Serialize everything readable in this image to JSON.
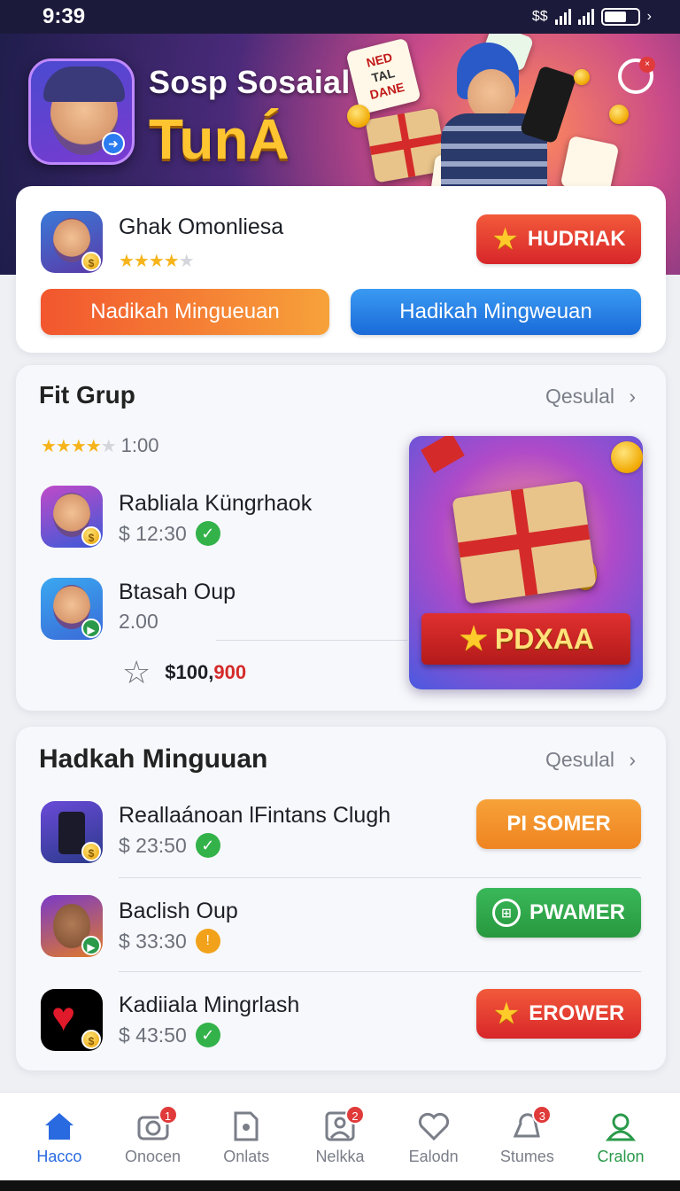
{
  "status_bar": {
    "time": "9:39",
    "icons": [
      "signal-icon",
      "wifi-icon",
      "battery-icon"
    ],
    "extra": "$$"
  },
  "hero": {
    "title": "Sosp Sosaial",
    "subtitle": "TunÁ",
    "tile_text": [
      "NED",
      "TAL",
      "DANE"
    ]
  },
  "featured": {
    "name": "Ghak Omonliesa",
    "rating_stars": 4,
    "primary_button": "HUDRIAK",
    "button_left": "Nadikah Mingueuan",
    "button_right": "Hadikah Mingweuan"
  },
  "fit_group": {
    "title": "Fit Grup",
    "see_all": "Qesulal",
    "rating_stars": 4,
    "rating_value": "1:00",
    "items": [
      {
        "title": "Rabliala Küngrhaok",
        "sub": "$ 12:30",
        "status": "check"
      },
      {
        "title": "Btasah Oup",
        "sub": "2.00",
        "status": ""
      }
    ],
    "price_prefix": "$100,",
    "price_suffix": "900",
    "promo_label": "PDXAA"
  },
  "hadkah": {
    "title": "Hadkah Minguuan",
    "see_all": "Qesulal",
    "items": [
      {
        "title": "Reallaánoan lFintans Clugh",
        "sub": "$ 23:50",
        "status": "check",
        "button": "PI SOMER",
        "color": "#f08a28"
      },
      {
        "title": "Baclish Oup",
        "sub": "$ 33:30",
        "status": "info",
        "button": "PWAMER",
        "color": "#2fa84c"
      },
      {
        "title": "Kadiiala Mingrlash",
        "sub": "$ 43:50",
        "status": "check",
        "button": "EROWER",
        "color": "#dc2a2a"
      }
    ]
  },
  "nav": {
    "items": [
      {
        "label": "Hacco",
        "badge": ""
      },
      {
        "label": "Onocen",
        "badge": "1"
      },
      {
        "label": "Onlats",
        "badge": ""
      },
      {
        "label": "Nelkka",
        "badge": "2"
      },
      {
        "label": "Ealodn",
        "badge": ""
      },
      {
        "label": "Stumes",
        "badge": "3"
      },
      {
        "label": "Cralon",
        "badge": ""
      }
    ]
  },
  "colors": {
    "accent_blue": "#2a6ae0",
    "accent_red": "#dc2a2a",
    "accent_green": "#2a9a4a",
    "gold": "#ffc531"
  }
}
